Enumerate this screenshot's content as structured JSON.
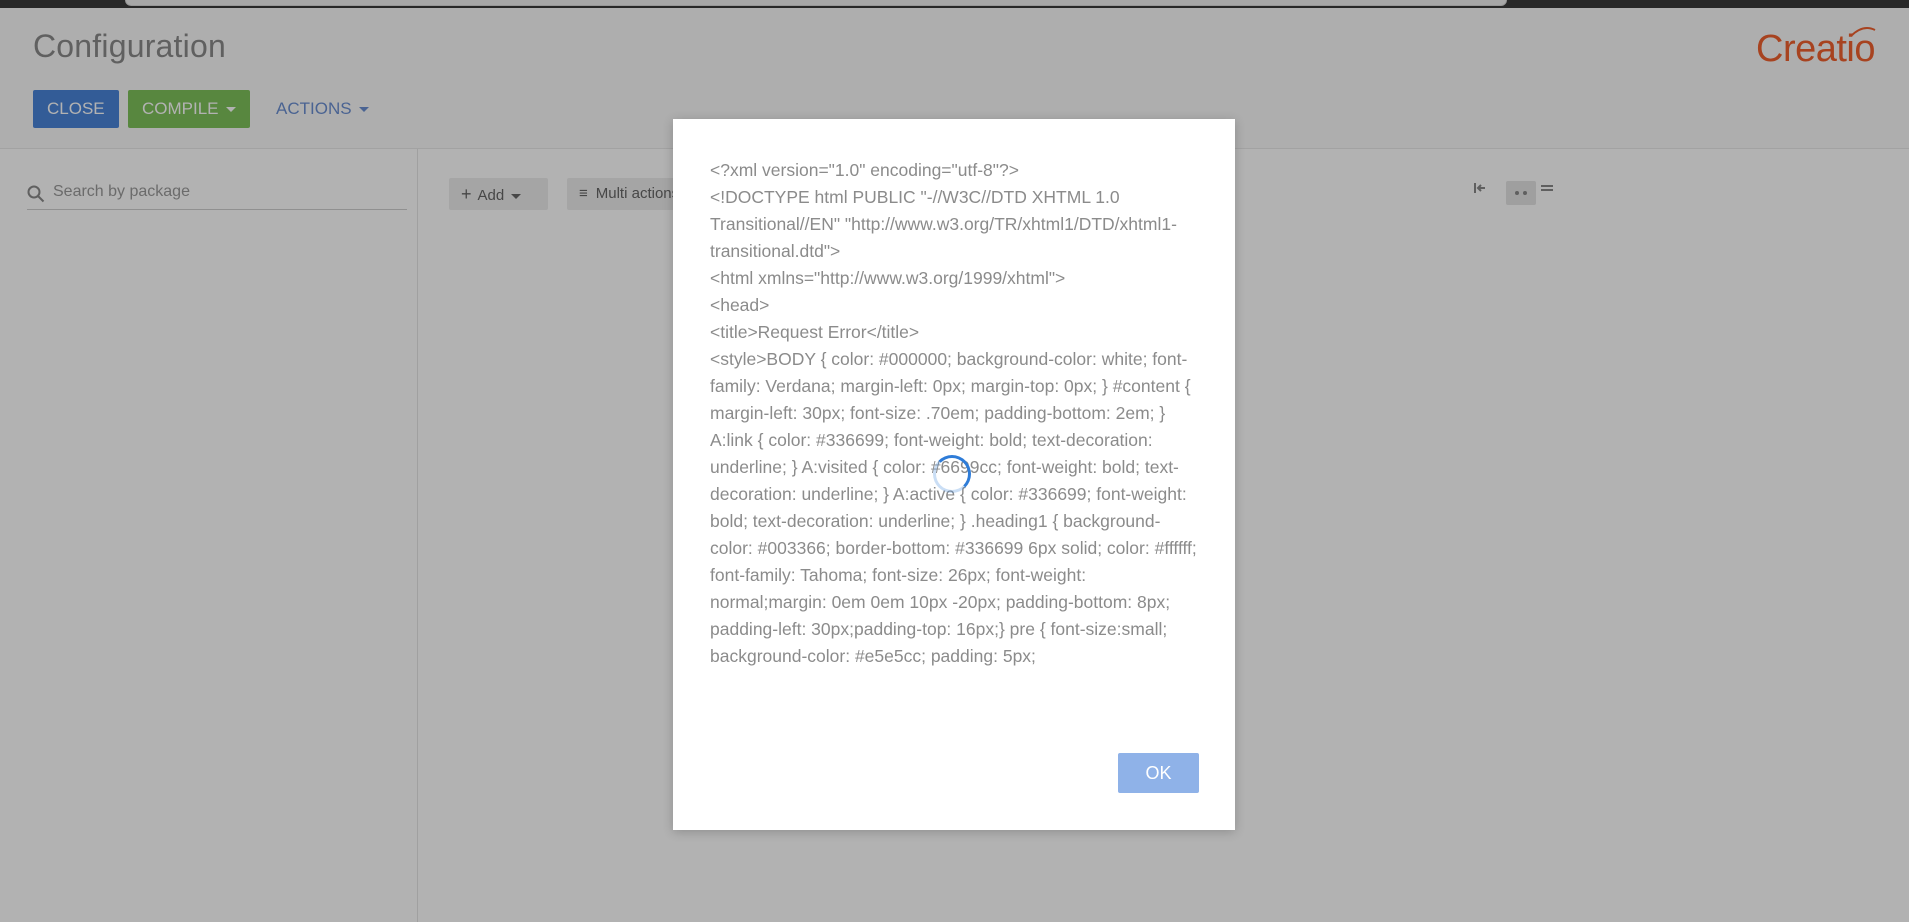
{
  "header": {
    "title": "Configuration",
    "close_label": "CLOSE",
    "compile_label": "COMPILE",
    "actions_label": "ACTIONS",
    "logo_text": "Creatio"
  },
  "sidebar": {
    "search_placeholder": "Search by package"
  },
  "toolbar": {
    "add_label": "Add",
    "multi_label": "Multi actions"
  },
  "dialog": {
    "message": "<?xml version=\"1.0\" encoding=\"utf-8\"?>\n<!DOCTYPE html PUBLIC \"-//W3C//DTD XHTML 1.0 Transitional//EN\" \"http://www.w3.org/TR/xhtml1/DTD/xhtml1-transitional.dtd\">\n<html xmlns=\"http://www.w3.org/1999/xhtml\">\n<head>\n<title>Request Error</title>\n<style>BODY { color: #000000; background-color: white; font-family: Verdana; margin-left: 0px; margin-top: 0px; } #content { margin-left: 30px; font-size: .70em; padding-bottom: 2em; } A:link { color: #336699; font-weight: bold; text-decoration: underline; } A:visited { color: #6699cc; font-weight: bold; text-decoration: underline; } A:active { color: #336699; font-weight: bold; text-decoration: underline; } .heading1 { background-color: #003366; border-bottom: #336699 6px solid; color: #ffffff; font-family: Tahoma; font-size: 26px; font-weight: normal;margin: 0em 0em 10px -20px; padding-bottom: 8px; padding-left: 30px;padding-top: 16px;} pre { font-size:small; background-color: #e5e5cc; padding: 5px;",
    "ok_label": "OK"
  },
  "colors": {
    "primary": "#4a85d9",
    "compile": "#7fc25b",
    "brand": "#f0602e",
    "spinner": "#2e7cd8"
  }
}
